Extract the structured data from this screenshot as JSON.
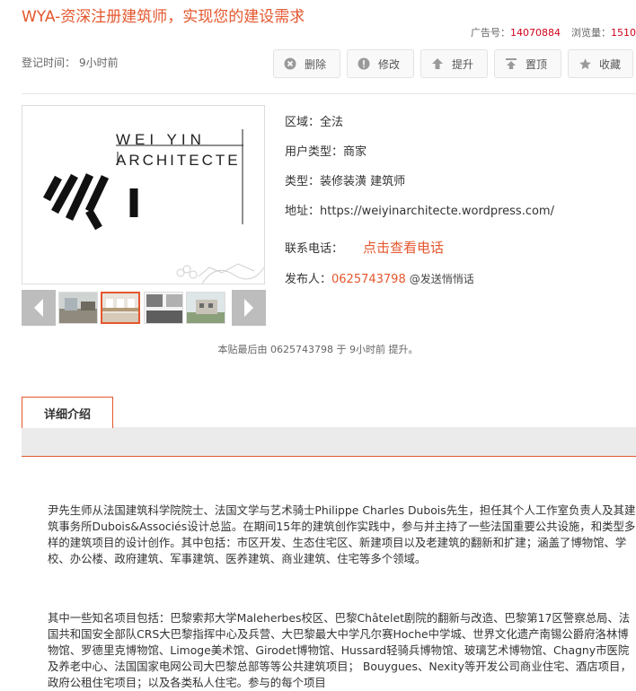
{
  "header": {
    "title": "WYA-资深注册建筑师，实现您的建设需求",
    "ad_label": "广告号：",
    "ad_number": "14070884",
    "views_label": "浏览量：",
    "views": "1510"
  },
  "meta": {
    "reg_label": "登记时间：",
    "reg_value": "9小时前"
  },
  "actions": {
    "delete": "删除",
    "edit": "修改",
    "bump": "提升",
    "pin": "置顶",
    "favorite": "收藏"
  },
  "logo": {
    "line1": "WEI YIN",
    "line2": "ARCHITECTE"
  },
  "info": {
    "region_label": "区域：",
    "region": "全法",
    "user_type_label": "用户类型：",
    "user_type": "商家",
    "category_label": "类型：",
    "category": "装修装潢 建筑师",
    "address_label": "地址：",
    "address": "https://weiyinarchitecte.wordpress.com/",
    "phone_label": "联系电话：",
    "phone_link": "点击查看电话",
    "poster_label": "发布人：",
    "poster": "0625743798",
    "whisper": "@发送悄悄话"
  },
  "last_note": "本贴最后由 0625743798 于 9小时前 提升。",
  "tab": {
    "label": "详细介绍"
  },
  "description": {
    "p1": "尹先生师从法国建筑科学院院士、法国文学与艺术骑士Philippe Charles Dubois先生，担任其个人工作室负责人及其建筑事务所Dubois&Associés设计总监。在期间15年的建筑创作实践中，参与并主持了一些法国重要公共设施，和类型多样的建筑项目的设计创作。其中包括：市区开发、生态住宅区、新建项目以及老建筑的翻新和扩建；涵盖了博物馆、学校、办公楼、政府建筑、军事建筑、医养建筑、商业建筑、住宅等多个领域。",
    "p2": "其中一些知名项目包括：巴黎索邦大学Maleherbes校区、巴黎Châtelet剧院的翻新与改造、巴黎第17区警察总局、法国共和国安全部队CRS大巴黎指挥中心及兵营、大巴黎最大中学凡尔赛Hoche中学城、世界文化遗产南锡公爵府洛林博物馆、罗德里克博物馆、Limoge美术馆、Girodet博物馆、Hussard轻骑兵博物馆、玻璃艺术博物馆、Chagny市医院及养老中心、法国国家电网公司大巴黎总部等等公共建筑项目； Bouygues、Nexity等开发公司商业住宅、酒店项目，政府公租住宅项目；以及各类私人住宅。参与的每个项目"
  },
  "colors": {
    "accent": "#e4572e",
    "count_red": "#d0021b",
    "arrow_grey": "#bdbdbd",
    "tabbar_grey": "#ebebeb"
  }
}
